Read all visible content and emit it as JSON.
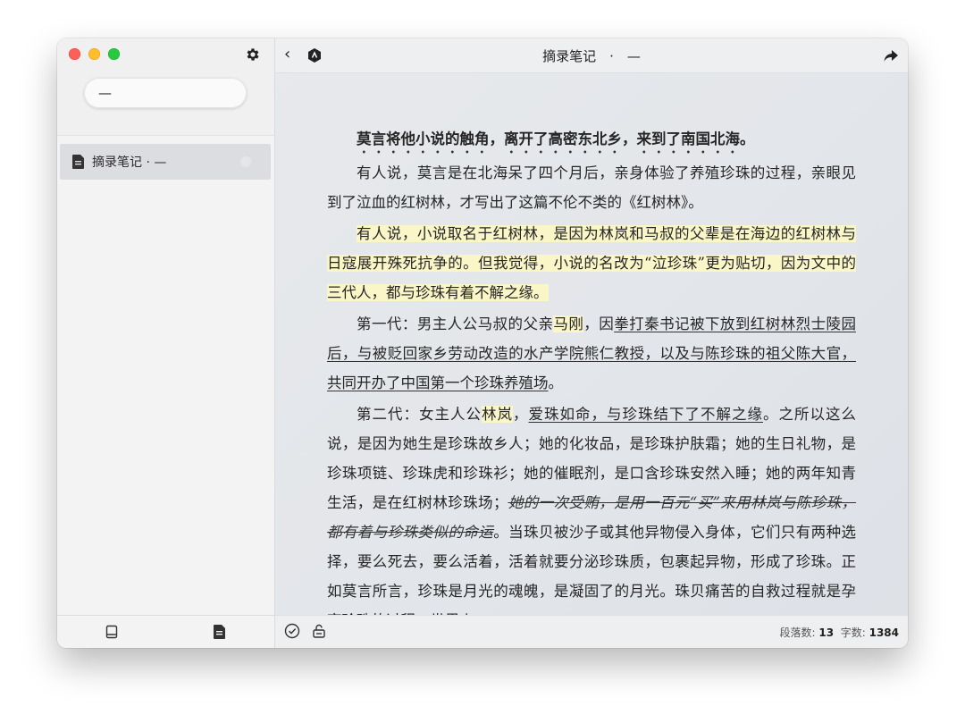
{
  "sidebar": {
    "search_value": "—",
    "items": [
      {
        "label": "摘录笔记 · —"
      }
    ]
  },
  "titlebar": {
    "title": "摘录笔记　·　—"
  },
  "article": {
    "p1": "莫言将他小说的触角，离开了高密东北乡，来到了南国北海。",
    "p2": "有人说，莫言是在北海呆了四个月后，亲身体验了养殖珍珠的过程，亲眼见到了泣血的红树林，才写出了这篇不伦不类的《红树林》。",
    "p3": "有人说，小说取名于红树林，是因为林岚和马叔的父辈是在海边的红树林与日寇展开殊死抗争的。但我觉得，小说的名改为“泣珍珠”更为贴切，因为文中的三代人，都与珍珠有着不解之缘。",
    "p4_a": "第一代：男主人公马叔的父亲",
    "p4_b": "马刚",
    "p4_c": "，因",
    "p4_d": "拳打秦书记被下放到红树林烈士陵园后，与被贬回家乡劳动改造的水产学院熊仁教授，以及与陈珍珠的祖父陈大官，共同开办了中国第一个珍珠养殖场",
    "p4_e": "。",
    "p5_a": "第二代：女主人公",
    "p5_b": "林岚",
    "p5_c": "，",
    "p5_d": "爱珠如命，与珍珠结下了不解之缘",
    "p5_e": "。之所以这么说，是因为她生是珍珠故乡人；她的化妆品，是珍珠护肤霜；她的生日礼物，是珍珠项链、珍珠虎和珍珠衫；她的催眠剂，是口含珍珠安然入睡；她的两年知青生活，是在红树林珍珠场；",
    "p5_f": "她的一次受贿，是用一百元“买”来用林岚与陈珍珠，都有着与珍珠类似的命运",
    "p5_g": "。当珠贝被沙子或其他异物侵入身体，它们只有两种选择，要么死去，要么活着，活着就要分泌珍珠质，包裹起异物，形成了珍珠。正如莫言所言，珍珠是月光的魂魄，是凝固了的月光。珠贝痛苦的自救过程就是孕育珍珠的过程，世界上"
  },
  "status": {
    "paragraphs_label": "段落数:",
    "paragraphs_value": "13",
    "words_label": "字数:",
    "words_value": "1384"
  }
}
